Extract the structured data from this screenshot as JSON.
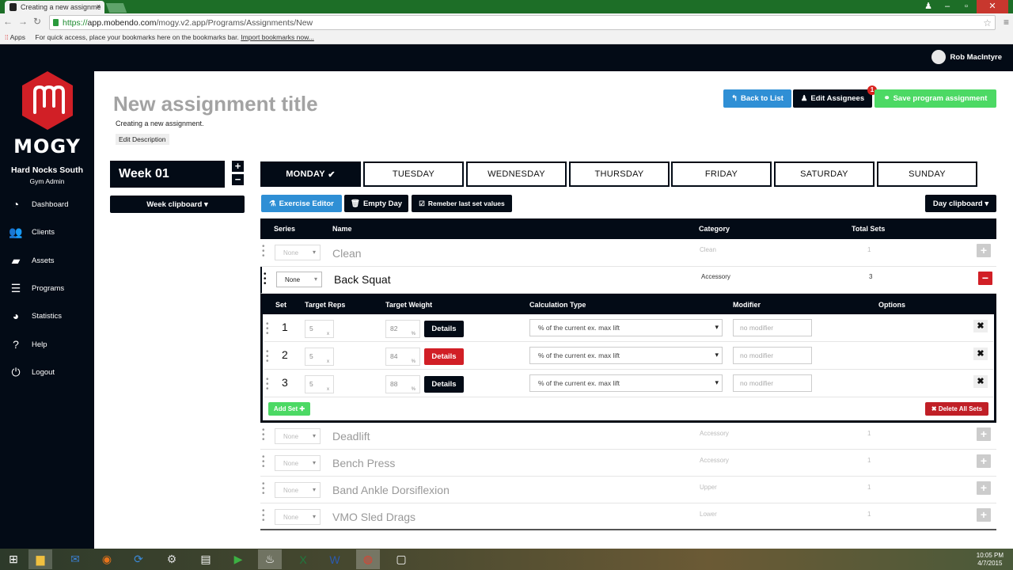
{
  "browser": {
    "tab_title": "Creating a new assignme",
    "url_scheme": "https://",
    "url_host": "app.mobendo.com",
    "url_path": "/mogy.v2.app/Programs/Assignments/New",
    "bookmarks_apps": "Apps",
    "bookmarks_hint": "For quick access, place your bookmarks here on the bookmarks bar.",
    "bookmarks_import": "Import bookmarks now..."
  },
  "topbar": {
    "user_name": "Rob MacIntyre"
  },
  "sidebar": {
    "brand": "MOGY",
    "org": "Hard Nocks South",
    "role": "Gym Admin",
    "items": [
      {
        "label": "Dashboard",
        "icon": "dashboard-icon"
      },
      {
        "label": "Clients",
        "icon": "clients-icon"
      },
      {
        "label": "Assets",
        "icon": "assets-icon"
      },
      {
        "label": "Programs",
        "icon": "programs-icon"
      },
      {
        "label": "Statistics",
        "icon": "statistics-icon"
      },
      {
        "label": "Help",
        "icon": "help-icon"
      },
      {
        "label": "Logout",
        "icon": "logout-icon"
      }
    ]
  },
  "header": {
    "title": "New assignment title",
    "subtitle": "Creating a new assignment.",
    "edit_description": "Edit Description",
    "back_to_list": "Back to List",
    "edit_assignees": "Edit Assignees",
    "assignees_badge": "1",
    "save": "Save program assignment"
  },
  "week": {
    "label": "Week 01",
    "plus": "+",
    "minus": "−",
    "clipboard": "Week clipboard ▾"
  },
  "days": [
    "MONDAY",
    "TUESDAY",
    "WEDNESDAY",
    "THURSDAY",
    "FRIDAY",
    "SATURDAY",
    "SUNDAY"
  ],
  "day_check": "✔",
  "toolbar": {
    "exercise_editor": "Exercise Editor",
    "empty_day": "Empty Day",
    "remember": "Remeber last set values",
    "day_clipboard": "Day clipboard ▾"
  },
  "table": {
    "headers": {
      "series": "Series",
      "name": "Name",
      "category": "Category",
      "total_sets": "Total Sets"
    },
    "exercises": [
      {
        "series": "None",
        "name": "Clean",
        "category": "Clean",
        "total_sets": "1",
        "toggle": "+"
      },
      {
        "series": "None",
        "name": "Back Squat",
        "category": "Accessory",
        "total_sets": "3",
        "toggle": "−"
      },
      {
        "series": "None",
        "name": "Deadlift",
        "category": "Accessory",
        "total_sets": "1",
        "toggle": "+"
      },
      {
        "series": "None",
        "name": "Bench Press",
        "category": "Accessory",
        "total_sets": "1",
        "toggle": "+"
      },
      {
        "series": "None",
        "name": "Band Ankle Dorsiflexion",
        "category": "Upper",
        "total_sets": "1",
        "toggle": "+"
      },
      {
        "series": "None",
        "name": "VMO Sled Drags",
        "category": "Lower",
        "total_sets": "1",
        "toggle": "+"
      }
    ]
  },
  "sets": {
    "headers": {
      "set": "Set",
      "reps": "Target Reps",
      "weight": "Target Weight",
      "calc": "Calculation Type",
      "modifier": "Modifier",
      "options": "Options"
    },
    "rows": [
      {
        "set": "1",
        "reps": "5",
        "reps_unit": "x",
        "weight": "82",
        "weight_unit": "%",
        "details": "Details",
        "calc": "% of the current ex. max lift",
        "modifier": "no modifier",
        "remove": "✖"
      },
      {
        "set": "2",
        "reps": "5",
        "reps_unit": "x",
        "weight": "84",
        "weight_unit": "%",
        "details": "Details",
        "calc": "% of the current ex. max lift",
        "modifier": "no modifier",
        "remove": "✖"
      },
      {
        "set": "3",
        "reps": "5",
        "reps_unit": "x",
        "weight": "88",
        "weight_unit": "%",
        "details": "Details",
        "calc": "% of the current ex. max lift",
        "modifier": "no modifier",
        "remove": "✖"
      }
    ],
    "add_set": "Add Set ✚",
    "delete_all": "✖ Delete All Sets"
  },
  "taskbar": {
    "time": "10:05 PM",
    "date": "4/7/2015"
  },
  "colors": {
    "dark": "#030b16",
    "blue": "#2f8fd5",
    "green": "#4cd964",
    "red": "#d11f26"
  }
}
